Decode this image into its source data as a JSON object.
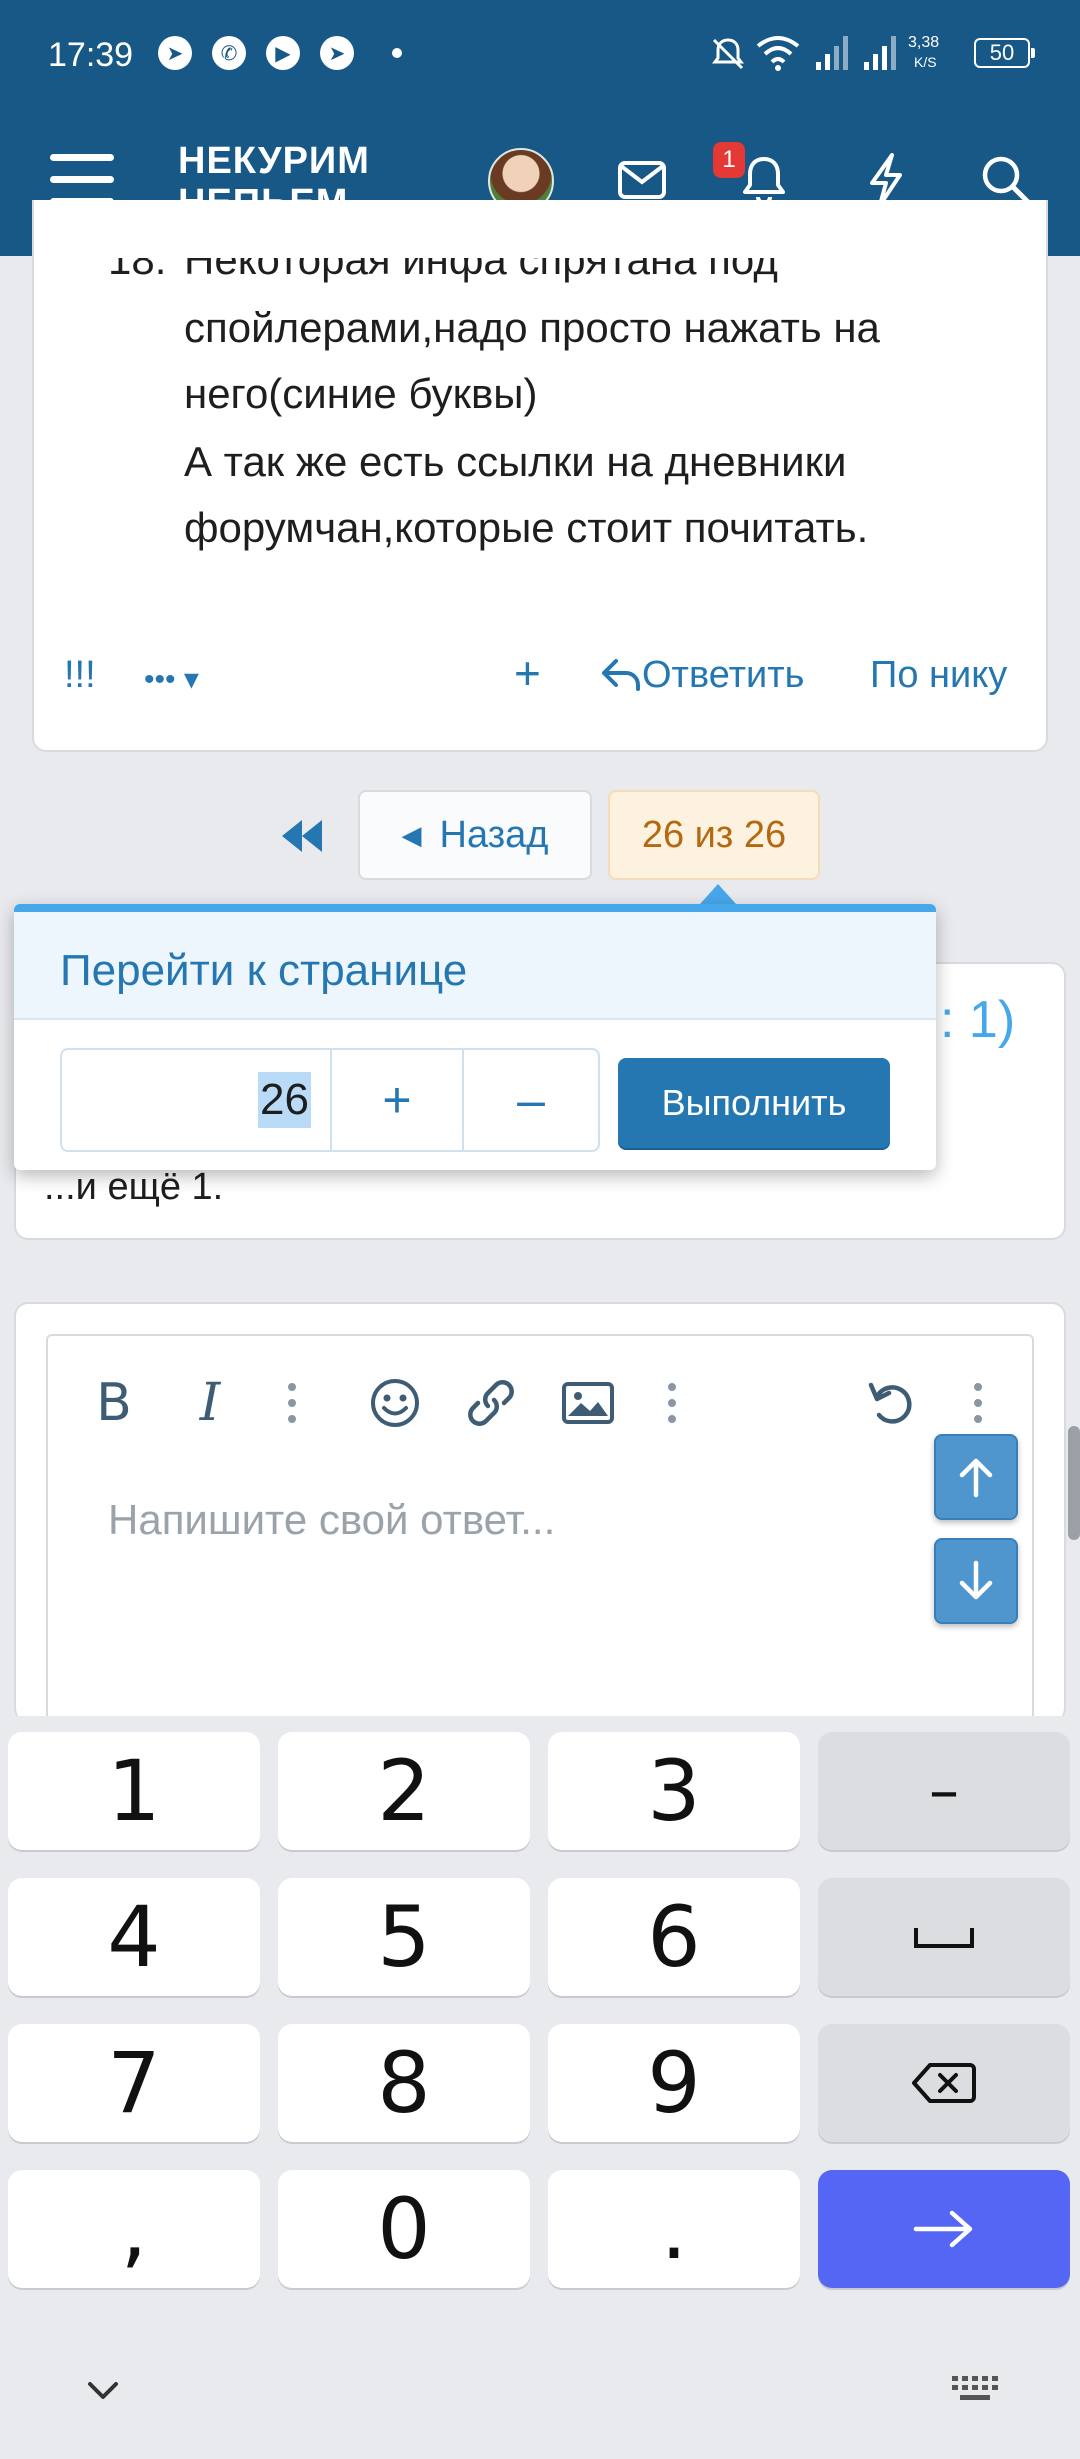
{
  "status_bar": {
    "time": "17:39",
    "network_speed_value": "3,38",
    "network_speed_unit": "K/S",
    "battery": "50",
    "icons": [
      "telegram-icon",
      "viber-icon",
      "message-icon",
      "telegram-icon",
      "dot-icon",
      "mute-icon",
      "wifi-icon",
      "signal-icon",
      "signal-icon",
      "battery-icon"
    ]
  },
  "header": {
    "title_line1": "НЕКУРИМ",
    "title_line2": "НЕПЬЕМ...",
    "notification_count": "1",
    "accent": "#185886"
  },
  "post": {
    "list_number": "18.",
    "lines": [
      "Некоторая инфа спрятана под",
      "спойлерами,надо просто нажать на",
      "него(синие буквы)",
      "А так же есть ссылки на дневники",
      "форумчан,которые стоит почитать."
    ],
    "actions": {
      "report": "!!!",
      "more": "•••",
      "add": "+",
      "reply": "Ответить",
      "by_nick": "По нику"
    }
  },
  "pagination": {
    "back": "Назад",
    "current": "26 из 26"
  },
  "background_card": {
    "partial_right": ": 1)",
    "more_text": "...и ещё 1."
  },
  "goto_popup": {
    "title": "Перейти к странице",
    "page_value": "26",
    "plus": "+",
    "minus": "–",
    "submit": "Выполнить"
  },
  "editor": {
    "bold": "B",
    "italic": "I",
    "placeholder": "Напишите свой ответ..."
  },
  "keyboard": {
    "row1": [
      "1",
      "2",
      "3",
      "–"
    ],
    "row2": [
      "4",
      "5",
      "6",
      "␣"
    ],
    "row3": [
      "7",
      "8",
      "9",
      "⌫"
    ],
    "row4": [
      ",",
      "0",
      ".",
      "→"
    ],
    "enter_color": "#5566f5"
  }
}
